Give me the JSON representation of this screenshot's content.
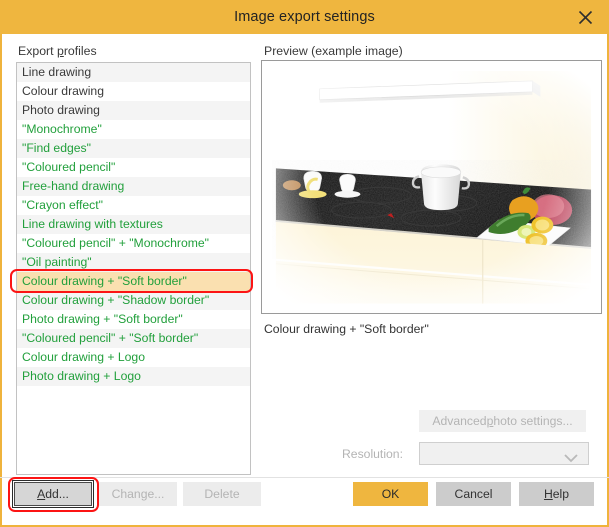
{
  "window": {
    "title": "Image export settings",
    "close_icon": "close-icon",
    "titlebar_color": "#efb63f",
    "border_color": "#efb33c"
  },
  "left_panel": {
    "label_prefix": "Export ",
    "label_accel": "p",
    "label_suffix": "rofiles",
    "profiles": [
      {
        "label": "Line drawing",
        "style": "dark",
        "selected": false
      },
      {
        "label": "Colour drawing",
        "style": "dark",
        "selected": false
      },
      {
        "label": "Photo drawing",
        "style": "dark",
        "selected": false
      },
      {
        "label": "\"Monochrome\"",
        "style": "green",
        "selected": false
      },
      {
        "label": "\"Find edges\"",
        "style": "green",
        "selected": false
      },
      {
        "label": "\"Coloured pencil\"",
        "style": "green",
        "selected": false
      },
      {
        "label": "Free-hand drawing",
        "style": "green",
        "selected": false
      },
      {
        "label": "\"Crayon effect\"",
        "style": "green",
        "selected": false
      },
      {
        "label": "Line drawing with textures",
        "style": "green",
        "selected": false
      },
      {
        "label": "\"Coloured pencil\" + \"Monochrome\"",
        "style": "green",
        "selected": false
      },
      {
        "label": "\"Oil painting\"",
        "style": "green",
        "selected": false
      },
      {
        "label": "Colour drawing + \"Soft border\"",
        "style": "green",
        "selected": true
      },
      {
        "label": "Colour drawing + \"Shadow border\"",
        "style": "green",
        "selected": false
      },
      {
        "label": "Photo drawing  + \"Soft border\"",
        "style": "green",
        "selected": false
      },
      {
        "label": "\"Coloured pencil\" + \"Soft border\"",
        "style": "green",
        "selected": false
      },
      {
        "label": "Colour drawing + Logo",
        "style": "green",
        "selected": false
      },
      {
        "label": "Photo drawing + Logo",
        "style": "green",
        "selected": false
      }
    ],
    "selected_color": "#fae0b0",
    "green_color": "#22a03c"
  },
  "right_panel": {
    "preview_label": "Preview (example image)",
    "preview_caption": "Colour drawing + \"Soft border\"",
    "preview_alt": "kitchen-counter-render",
    "advanced_prefix": "Advanced ",
    "advanced_accel": "p",
    "advanced_suffix": "hoto settings...",
    "resolution_label": "Resolution:",
    "resolution_value": "",
    "chevron_icon": "chevron-down-icon"
  },
  "footer": {
    "add_prefix": "",
    "add_accel": "A",
    "add_suffix": "dd...",
    "change_label": "Change...",
    "delete_label": "Delete",
    "ok_label": "OK",
    "cancel_label": "Cancel",
    "help_prefix": "",
    "help_accel": "H",
    "help_suffix": "elp",
    "ok_color": "#efb63f"
  },
  "annotations": {
    "color": "#fc1414",
    "selected_row_highlight": "Colour drawing + \"Soft border\"",
    "add_button_highlight": "Add..."
  }
}
